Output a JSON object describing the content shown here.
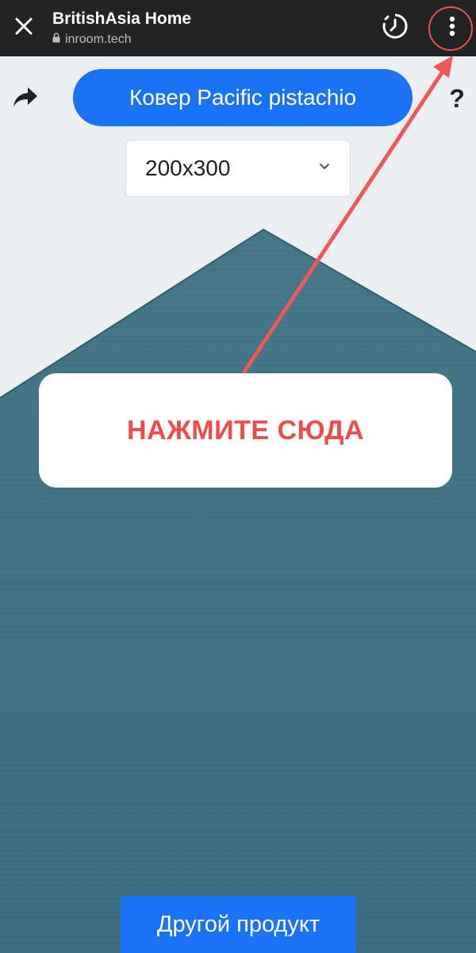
{
  "browser": {
    "title": "BritishAsia Home",
    "url": "inroom.tech",
    "close_icon": "close-icon",
    "lock_icon": "lock-icon",
    "history_icon": "history-timer-icon",
    "menu_icon": "more-vert-icon"
  },
  "toolbar": {
    "share_icon": "share-arrow-icon",
    "product_label": "Ковер Pacific pistachio",
    "help_label": "?"
  },
  "size_select": {
    "value": "200x300",
    "icon": "chevron-down-icon"
  },
  "callout": {
    "text": "НАЖМИТЕ СЮДА"
  },
  "footer": {
    "button_label": "Другой продукт"
  },
  "colors": {
    "accent": "#1a73f4",
    "annotation_red": "#ef4b4b",
    "rug": "#3f7282",
    "browser_bar": "#232323",
    "background": "#eceff1"
  }
}
